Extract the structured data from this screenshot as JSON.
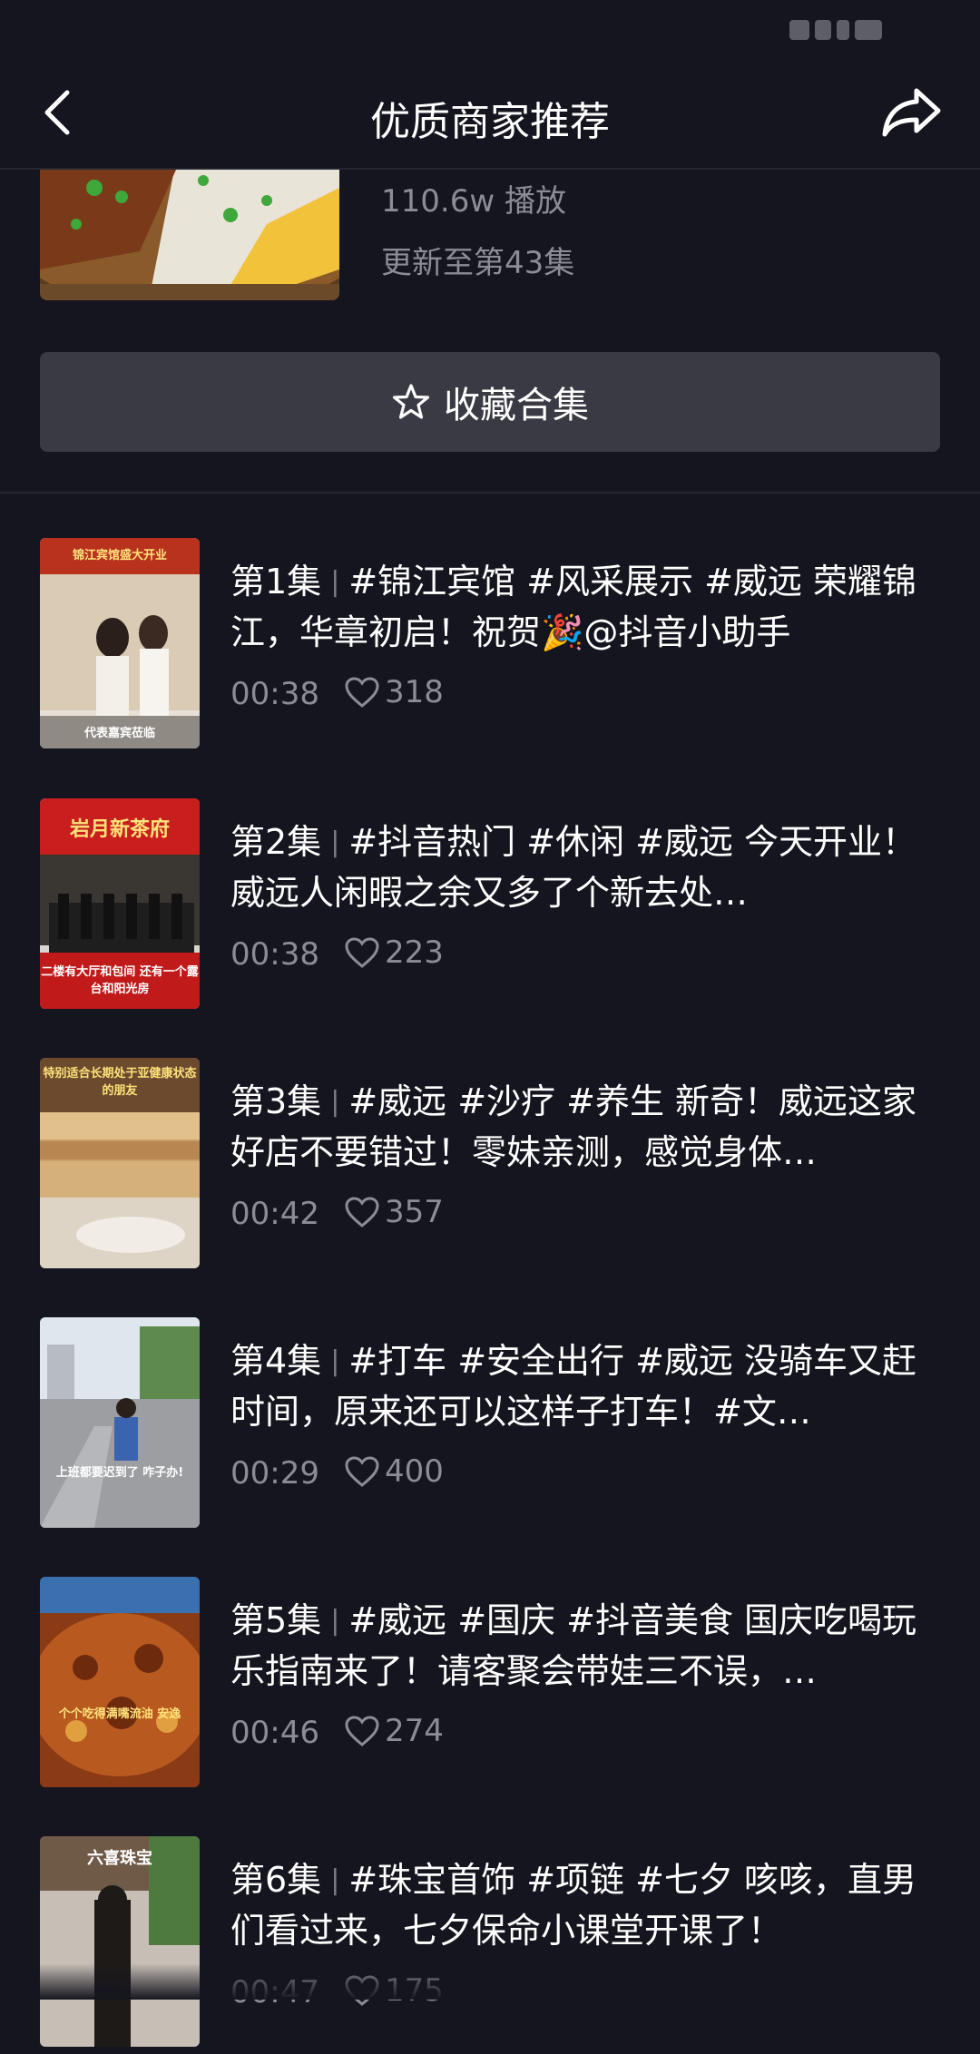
{
  "header": {
    "title": "优质商家推荐"
  },
  "collection": {
    "plays": "110.6w 播放",
    "updated": "更新至第43集",
    "collect_label": "收藏合集"
  },
  "episodes": [
    {
      "num": "第1集",
      "text": "#锦江宾馆 #风采展示 #威远 荣耀锦江，华章初启！祝贺🎉@抖音小助手",
      "duration": "00:38",
      "likes": "318",
      "thumb_top": "锦江宾馆盛大开业",
      "thumb_bottom": "代表嘉宾莅临"
    },
    {
      "num": "第2集",
      "text": "#抖音热门 #休闲 #威远 今天开业！威远人闲暇之余又多了个新去处…",
      "duration": "00:38",
      "likes": "223",
      "thumb_top": "岩月新茶府",
      "thumb_bottom": "二楼有大厅和包间 还有一个露台和阳光房"
    },
    {
      "num": "第3集",
      "text": "#威远 #沙疗 #养生 新奇！威远这家好店不要错过！零妹亲测，感觉身体…",
      "duration": "00:42",
      "likes": "357",
      "thumb_top": "特别适合长期处于亚健康状态的朋友",
      "thumb_bottom": ""
    },
    {
      "num": "第4集",
      "text": "#打车 #安全出行 #威远 没骑车又赶时间，原来还可以这样子打车！#文…",
      "duration": "00:29",
      "likes": "400",
      "thumb_top": "",
      "thumb_bottom": "上班都要迟到了 咋子办!"
    },
    {
      "num": "第5集",
      "text": "#威远 #国庆 #抖音美食 国庆吃喝玩乐指南来了！请客聚会带娃三不误，…",
      "duration": "00:46",
      "likes": "274",
      "thumb_top": "",
      "thumb_bottom": "个个吃得满嘴流油 安逸"
    },
    {
      "num": "第6集",
      "text": "#珠宝首饰 #项链 #七夕 咳咳，直男们看过来，七夕保命小课堂开课了！",
      "duration": "00:47",
      "likes": "175",
      "thumb_top": "六喜珠宝",
      "thumb_bottom": ""
    }
  ]
}
